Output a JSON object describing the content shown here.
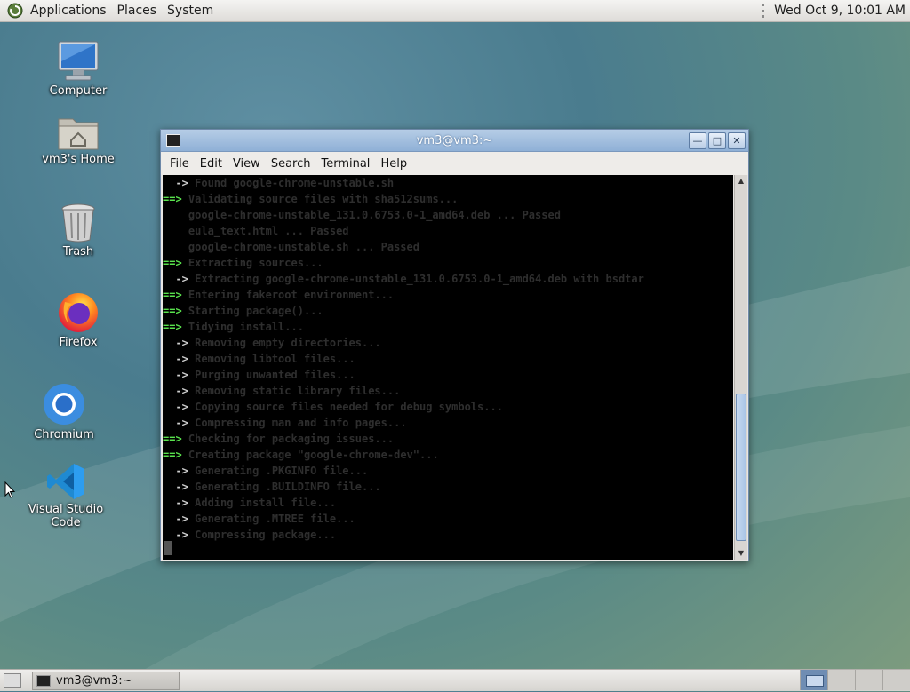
{
  "top_panel": {
    "menus": [
      "Applications",
      "Places",
      "System"
    ],
    "clock": "Wed Oct  9, 10:01 AM"
  },
  "desktop": {
    "icons": [
      {
        "label": "Computer",
        "icon": "computer-icon"
      },
      {
        "label": "vm3's Home",
        "icon": "home-folder-icon"
      },
      {
        "label": "Trash",
        "icon": "trash-icon"
      },
      {
        "label": "Firefox",
        "icon": "firefox-icon"
      },
      {
        "label": "Chromium",
        "icon": "chromium-icon"
      },
      {
        "label": "Visual Studio Code",
        "icon": "vscode-icon"
      }
    ]
  },
  "terminal": {
    "title": "vm3@vm3:~",
    "menus": [
      "File",
      "Edit",
      "View",
      "Search",
      "Terminal",
      "Help"
    ],
    "lines": [
      {
        "prefix": "  ->",
        "green": false,
        "text": " Found google-chrome-unstable.sh"
      },
      {
        "prefix": "==>",
        "green": true,
        "text": " Validating source files with sha512sums..."
      },
      {
        "prefix": "",
        "green": false,
        "text": "    google-chrome-unstable_131.0.6753.0-1_amd64.deb ... Passed"
      },
      {
        "prefix": "",
        "green": false,
        "text": "    eula_text.html ... Passed"
      },
      {
        "prefix": "",
        "green": false,
        "text": "    google-chrome-unstable.sh ... Passed"
      },
      {
        "prefix": "==>",
        "green": true,
        "text": " Extracting sources..."
      },
      {
        "prefix": "  ->",
        "green": false,
        "text": " Extracting google-chrome-unstable_131.0.6753.0-1_amd64.deb with bsdtar"
      },
      {
        "prefix": "==>",
        "green": true,
        "text": " Entering fakeroot environment..."
      },
      {
        "prefix": "==>",
        "green": true,
        "text": " Starting package()..."
      },
      {
        "prefix": "==>",
        "green": true,
        "text": " Tidying install..."
      },
      {
        "prefix": "  ->",
        "green": false,
        "text": " Removing empty directories..."
      },
      {
        "prefix": "  ->",
        "green": false,
        "text": " Removing libtool files..."
      },
      {
        "prefix": "  ->",
        "green": false,
        "text": " Purging unwanted files..."
      },
      {
        "prefix": "  ->",
        "green": false,
        "text": " Removing static library files..."
      },
      {
        "prefix": "  ->",
        "green": false,
        "text": " Copying source files needed for debug symbols..."
      },
      {
        "prefix": "  ->",
        "green": false,
        "text": " Compressing man and info pages..."
      },
      {
        "prefix": "==>",
        "green": true,
        "text": " Checking for packaging issues..."
      },
      {
        "prefix": "==>",
        "green": true,
        "text": " Creating package \"google-chrome-dev\"..."
      },
      {
        "prefix": "  ->",
        "green": false,
        "text": " Generating .PKGINFO file..."
      },
      {
        "prefix": "  ->",
        "green": false,
        "text": " Generating .BUILDINFO file..."
      },
      {
        "prefix": "  ->",
        "green": false,
        "text": " Adding install file..."
      },
      {
        "prefix": "  ->",
        "green": false,
        "text": " Generating .MTREE file..."
      },
      {
        "prefix": "  ->",
        "green": false,
        "text": " Compressing package..."
      }
    ]
  },
  "taskbar": {
    "task": "vm3@vm3:~",
    "workspace_count": 4,
    "active_workspace": 1
  },
  "colors": {
    "green_prompt": "#59e34d",
    "titlebar": "#8fb0d6"
  }
}
